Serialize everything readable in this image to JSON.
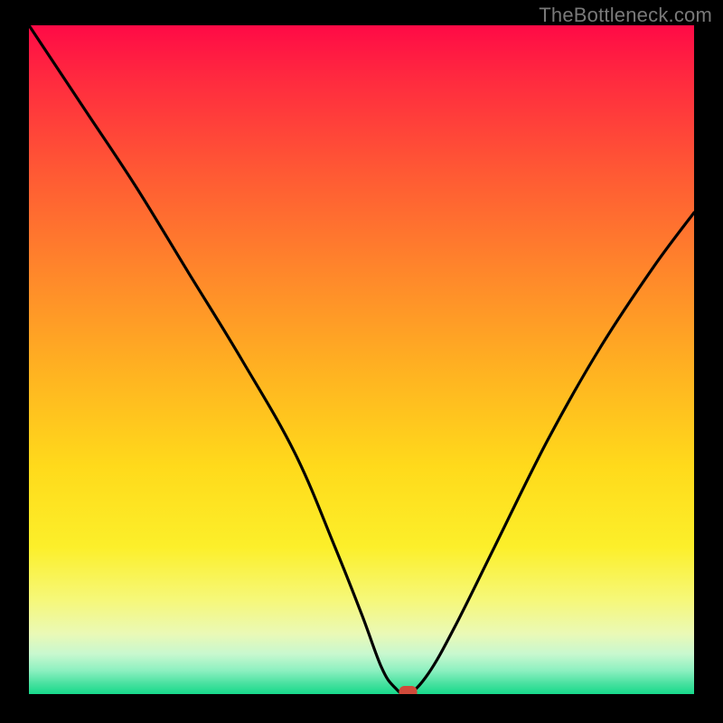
{
  "watermark": "TheBottleneck.com",
  "chart_data": {
    "type": "line",
    "title": "",
    "xlabel": "",
    "ylabel": "",
    "xlim": [
      0,
      100
    ],
    "ylim": [
      0,
      100
    ],
    "grid": false,
    "legend": false,
    "background_gradient": {
      "top_color": "#ff0a46",
      "bottom_color": "#17d98b",
      "stops": [
        {
          "pos": 0.0,
          "color": "#ff0a46"
        },
        {
          "pos": 0.22,
          "color": "#ff5934"
        },
        {
          "pos": 0.52,
          "color": "#ffb321"
        },
        {
          "pos": 0.78,
          "color": "#fcef2a"
        },
        {
          "pos": 0.94,
          "color": "#c8f8cf"
        },
        {
          "pos": 1.0,
          "color": "#17d98b"
        }
      ]
    },
    "series": [
      {
        "name": "bottleneck-curve",
        "x": [
          0,
          8,
          16,
          24,
          32,
          40,
          46,
          50,
          53,
          55,
          57,
          60,
          64,
          70,
          78,
          86,
          94,
          100
        ],
        "y": [
          100,
          88,
          76,
          63,
          50,
          36,
          22,
          12,
          4,
          1,
          0,
          3,
          10,
          22,
          38,
          52,
          64,
          72
        ]
      }
    ],
    "marker": {
      "x": 57,
      "y": 0,
      "shape": "rounded-rect",
      "color": "#d04a3a"
    }
  }
}
